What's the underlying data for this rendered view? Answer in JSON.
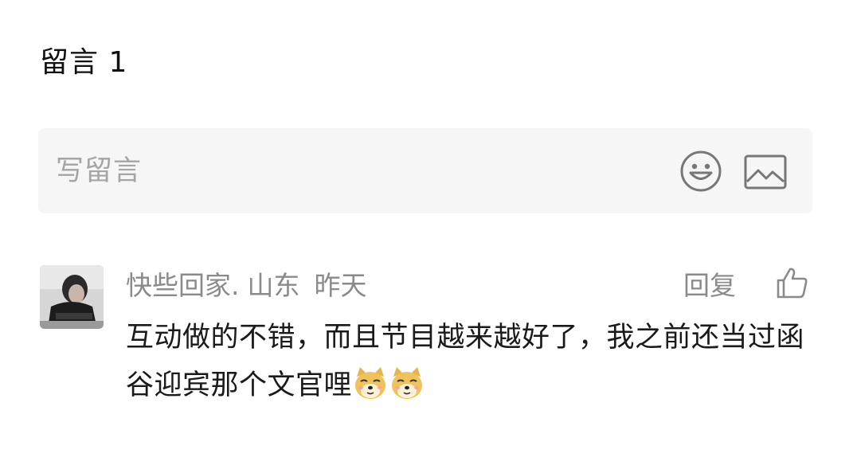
{
  "header": {
    "title": "留言 1"
  },
  "compose": {
    "placeholder": "写留言",
    "emoji_icon": "smiley-face-icon",
    "image_icon": "image-icon"
  },
  "comments": [
    {
      "author": "快些回家.",
      "location": "山东",
      "time": "昨天",
      "reply_label": "回复",
      "like_icon": "thumbs-up-icon",
      "text": "互动做的不错，而且节目越来越好了，我之前还当过函谷迎宾那个文官哩",
      "stickers": [
        "doge-emoji",
        "doge-emoji"
      ]
    }
  ]
}
